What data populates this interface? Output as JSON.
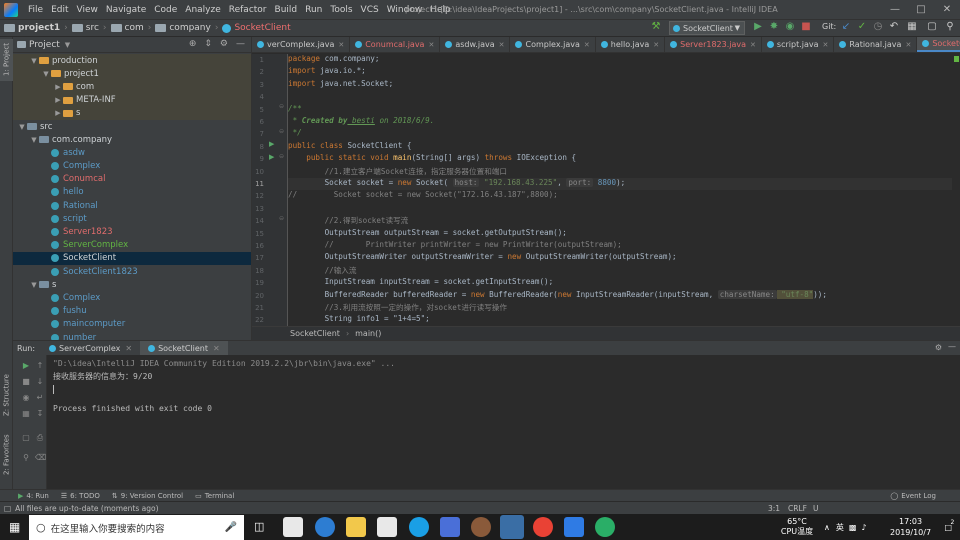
{
  "menubar": {
    "items": [
      "File",
      "Edit",
      "View",
      "Navigate",
      "Code",
      "Analyze",
      "Refactor",
      "Build",
      "Run",
      "Tools",
      "VCS",
      "Window",
      "Help"
    ],
    "title": "project1 [D:\\idea\\IdeaProjects\\project1] - ...\\src\\com\\company\\SocketClient.java - IntelliJ IDEA"
  },
  "navbar": {
    "crumbs": [
      "project1",
      "src",
      "com",
      "company",
      "SocketClient"
    ],
    "run_config": "SocketClient",
    "git_label": "Git:"
  },
  "project": {
    "title": "Project",
    "tree": [
      {
        "label": "production",
        "depth": 1,
        "kind": "folder",
        "arrow": "v",
        "style": "white",
        "bg": true
      },
      {
        "label": "project1",
        "depth": 2,
        "kind": "folder",
        "arrow": "v",
        "style": "white",
        "bg": true
      },
      {
        "label": "com",
        "depth": 3,
        "kind": "folder",
        "arrow": ">",
        "style": "white",
        "bg": true
      },
      {
        "label": "META-INF",
        "depth": 3,
        "kind": "folder",
        "arrow": ">",
        "style": "white",
        "bg": true
      },
      {
        "label": "s",
        "depth": 3,
        "kind": "folder",
        "arrow": ">",
        "style": "white",
        "bg": true
      },
      {
        "label": "src",
        "depth": 0,
        "kind": "folder",
        "arrow": "v",
        "style": "white"
      },
      {
        "label": "com.company",
        "depth": 1,
        "kind": "folder",
        "arrow": "v",
        "style": "white"
      },
      {
        "label": "asdw",
        "depth": 2,
        "kind": "class",
        "style": "blue"
      },
      {
        "label": "Complex",
        "depth": 2,
        "kind": "class",
        "style": "blue"
      },
      {
        "label": "Conumcal",
        "depth": 2,
        "kind": "class",
        "style": "red"
      },
      {
        "label": "hello",
        "depth": 2,
        "kind": "class",
        "style": "blue"
      },
      {
        "label": "Rational",
        "depth": 2,
        "kind": "class",
        "style": "blue"
      },
      {
        "label": "script",
        "depth": 2,
        "kind": "class",
        "style": "blue"
      },
      {
        "label": "Server1823",
        "depth": 2,
        "kind": "class",
        "style": "red"
      },
      {
        "label": "ServerComplex",
        "depth": 2,
        "kind": "class",
        "style": "green"
      },
      {
        "label": "SocketClient",
        "depth": 2,
        "kind": "class",
        "style": "white",
        "selected": true
      },
      {
        "label": "SocketClient1823",
        "depth": 2,
        "kind": "class",
        "style": "blue"
      },
      {
        "label": "s",
        "depth": 1,
        "kind": "folder",
        "arrow": "v",
        "style": "white"
      },
      {
        "label": "Complex",
        "depth": 2,
        "kind": "class",
        "style": "blue"
      },
      {
        "label": "fushu",
        "depth": 2,
        "kind": "class",
        "style": "blue"
      },
      {
        "label": "maincomputer",
        "depth": 2,
        "kind": "class",
        "style": "blue"
      },
      {
        "label": "number",
        "depth": 2,
        "kind": "class",
        "style": "blue"
      }
    ]
  },
  "editor": {
    "tabs": [
      {
        "label": "verComplex.java",
        "red": false,
        "active": false
      },
      {
        "label": "Conumcal.java",
        "red": true,
        "active": false
      },
      {
        "label": "asdw.java",
        "red": false,
        "active": false
      },
      {
        "label": "Complex.java",
        "red": false,
        "active": false
      },
      {
        "label": "hello.java",
        "red": false,
        "active": false
      },
      {
        "label": "Server1823.java",
        "red": true,
        "active": false
      },
      {
        "label": "script.java",
        "red": false,
        "active": false
      },
      {
        "label": "Rational.java",
        "red": false,
        "active": false
      },
      {
        "label": "SocketClient.java",
        "red": true,
        "active": true
      }
    ],
    "line_numbers": [
      "1",
      "2",
      "3",
      "4",
      "5",
      "6",
      "7",
      "8",
      "9",
      "10",
      "11",
      "12",
      "13",
      "14",
      "15",
      "16",
      "17",
      "18",
      "19",
      "20",
      "21",
      "22"
    ],
    "code": {
      "l1a": "package",
      "l1b": " com.company;",
      "l2a": "import",
      "l2b": " java.io.*;",
      "l3a": "import",
      "l3b": " java.net.Socket;",
      "l5": "/**",
      "l6a": " * ",
      "l6b": "Created by",
      "l6c": " besti",
      "l6d": " on 2018/6/9.",
      "l7": " */",
      "l8a": "public class",
      "l8b": " SocketClient {",
      "l9a": "    public static void ",
      "l9b": "main",
      "l9c": "(String[] args) ",
      "l9d": "throws",
      "l9e": " IOException {",
      "l10": "        //1.建立客户端Socket连接，指定服务器位置和端口",
      "l11a": "        Socket socket = ",
      "l11b": "new",
      "l11c": " Socket( ",
      "l11d": "host:",
      "l11e": " \"192.168.43.225\"",
      "l11f": ", ",
      "l11g": "port:",
      "l11h": " 8800",
      "l11i": ");",
      "l12": "//        Socket socket = new Socket(\"172.16.43.187\",8800);",
      "l14": "        //2.得到socket读写流",
      "l15": "        OutputStream outputStream = socket.getOutputStream();",
      "l16": "        //       PrintWriter printWriter = new PrintWriter(outputStream);",
      "l17a": "        OutputStreamWriter outputStreamWriter = ",
      "l17b": "new",
      "l17c": " OutputStreamWriter(outputStream);",
      "l18": "        //输入流",
      "l19": "        InputStream inputStream = socket.getInputStream();",
      "l20a": "        BufferedReader bufferedReader = ",
      "l20b": "new",
      "l20c": " BufferedReader(",
      "l20d": "new",
      "l20e": " InputStreamReader(inputStream, ",
      "l20f": "charsetName:",
      "l20g": " \"utf-8\"",
      "l20h": "));",
      "l21": "        //3.利用流按照一定的操作，对socket进行读写操作",
      "l22": "        String info1 = \"1+4=5\";"
    },
    "breadcrumb": [
      "SocketClient",
      "main()"
    ]
  },
  "run": {
    "label": "Run:",
    "tabs": [
      "ServerComplex",
      "SocketClient"
    ],
    "console": [
      "\"D:\\idea\\IntelliJ IDEA Community Edition 2019.2.2\\jbr\\bin\\java.exe\" ...",
      "接收服务器的信息为：9/20",
      "",
      "",
      "Process finished with exit code 0"
    ]
  },
  "toolwindows": {
    "run": "4: Run",
    "todo": "6: TODO",
    "vcs": "9: Version Control",
    "terminal": "Terminal",
    "event_log": "Event Log",
    "left_structure": "Z: Structure",
    "left_favorites": "2: Favorites",
    "left_project": "1: Project"
  },
  "status": {
    "message": "All files are up-to-date (moments ago)",
    "position": "3:1",
    "line_sep": "CRLF",
    "encoding": "U"
  },
  "taskbar": {
    "search_placeholder": "在这里输入你要搜索的内容",
    "cpu_temp": "65°C",
    "cpu_label": "CPU温度",
    "time": "17:03",
    "date": "2019/10/7",
    "ime": "英",
    "notif_count": "2"
  }
}
